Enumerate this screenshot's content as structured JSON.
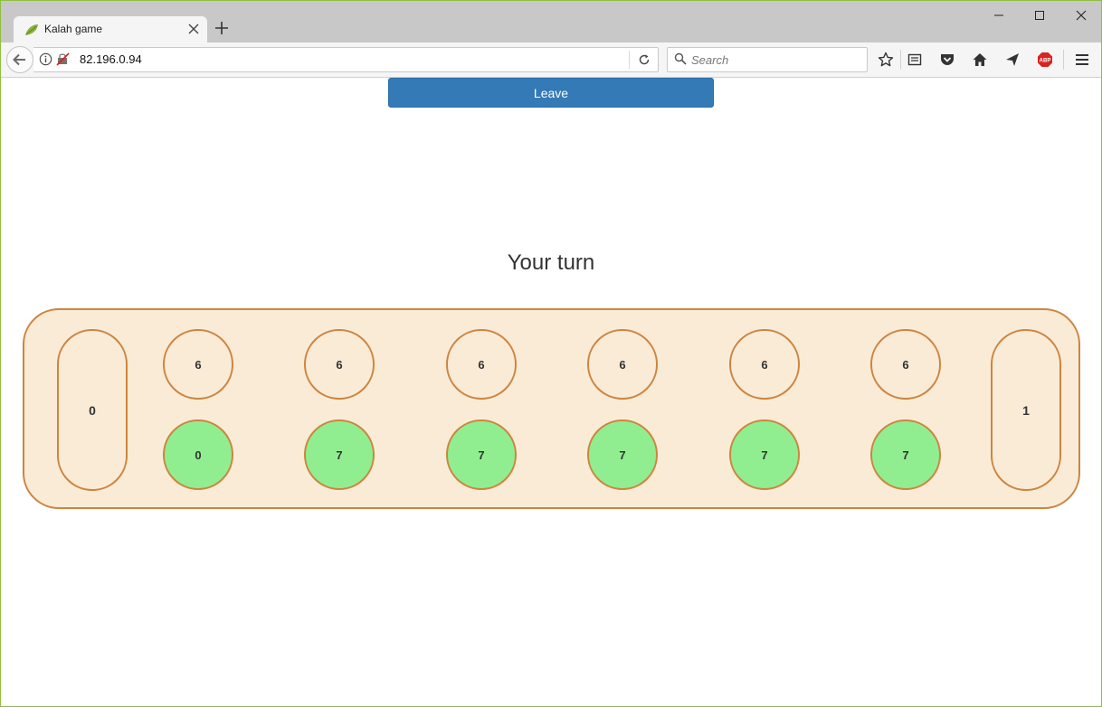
{
  "browser": {
    "tab_title": "Kalah game",
    "url": "82.196.0.94",
    "search_placeholder": "Search"
  },
  "game": {
    "leave_label": "Leave",
    "status_text": "Your turn",
    "left_store": "0",
    "right_store": "1",
    "top_pits": [
      "6",
      "6",
      "6",
      "6",
      "6",
      "6"
    ],
    "bottom_pits": [
      "0",
      "7",
      "7",
      "7",
      "7",
      "7"
    ],
    "colors": {
      "board_fill": "#faebd7",
      "border": "#cd853f",
      "player_pit": "#90ee90",
      "button": "#337ab7"
    }
  }
}
